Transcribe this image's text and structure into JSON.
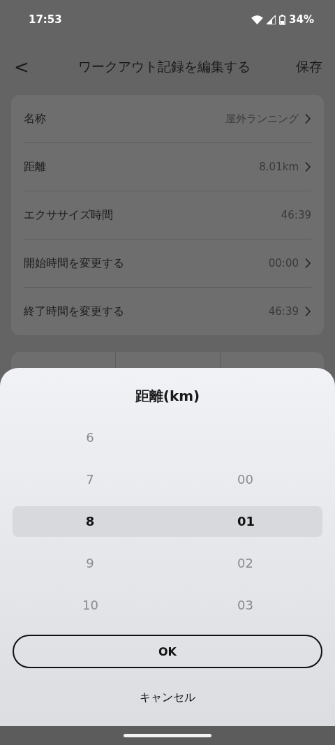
{
  "status_bar": {
    "time": "17:53",
    "battery": "34%"
  },
  "header": {
    "back": "<",
    "title": "ワークアウト記録を編集する",
    "action": "保存"
  },
  "rows": [
    {
      "label": "名称",
      "value": "屋外ランニング",
      "chevron": true
    },
    {
      "label": "距離",
      "value": "8.01km",
      "chevron": true
    },
    {
      "label": "エクササイズ時間",
      "value": "46:39",
      "chevron": false
    },
    {
      "label": "開始時間を変更する",
      "value": "00:00",
      "chevron": true
    },
    {
      "label": "終了時間を変更する",
      "value": "46:39",
      "chevron": true
    }
  ],
  "stats": [
    {
      "kind": "cell"
    },
    {
      "kind": "cell"
    },
    {
      "kind": "cell"
    }
  ],
  "sheet": {
    "title": "距離(km)",
    "columns": [
      {
        "items": [
          {
            "text": "6",
            "selected": false
          },
          {
            "text": "7",
            "selected": false
          },
          {
            "text": "8",
            "selected": true
          },
          {
            "text": "9",
            "selected": false
          },
          {
            "text": "10",
            "selected": false
          }
        ]
      },
      {
        "items": [
          {
            "text": "00",
            "selected": false
          },
          {
            "text": "01",
            "selected": true
          },
          {
            "text": "02",
            "selected": false
          },
          {
            "text": "03",
            "selected": false
          }
        ]
      }
    ],
    "ok": "OK",
    "cancel": "キャンセル"
  }
}
